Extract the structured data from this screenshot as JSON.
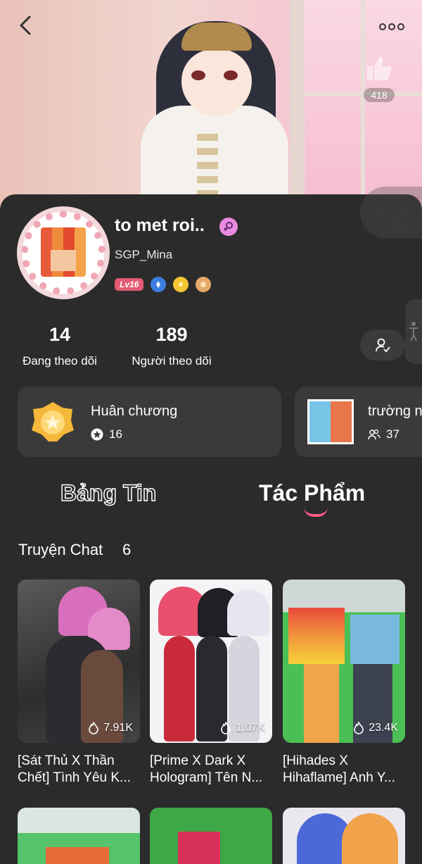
{
  "header": {
    "likes_count": "418"
  },
  "profile": {
    "name": "to met roi..",
    "handle": "SGP_Mina",
    "level": "Lv16"
  },
  "stats": {
    "following_count": "14",
    "following_label": "Đang theo dõi",
    "followers_count": "189",
    "followers_label": "Người theo dõi"
  },
  "cards": {
    "medals": {
      "title": "Huân chương",
      "count": "16"
    },
    "group": {
      "title": "trường n",
      "count": "37"
    }
  },
  "tabs": {
    "feed": "Bảng Tin",
    "works": "Tác Phẩm"
  },
  "section": {
    "title": "Truyện Chat",
    "count": "6"
  },
  "stories": [
    {
      "views": "7.91K",
      "caption": "[Sát Thủ X Thần\nChết] Tình Yêu K..."
    },
    {
      "views": "1.07K",
      "caption": "[Prime X Dark X\nHologram] Tên N..."
    },
    {
      "views": "23.4K",
      "caption": "[Hihades X\nHihaflame] Anh Y..."
    }
  ],
  "colors": {
    "background": "#2b2b2b",
    "card": "#3a3a3a",
    "accent_pink": "#ff5a86",
    "level_badge": "#e25a73"
  },
  "icons": [
    "back-icon",
    "more-icon",
    "thumbs-up-icon",
    "grid-icon",
    "gender-female-icon",
    "follow-check-icon",
    "star-icon",
    "people-icon",
    "flame-icon"
  ]
}
